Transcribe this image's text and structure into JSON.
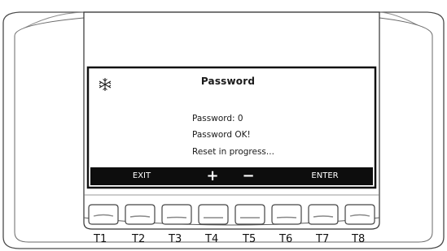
{
  "screen": {
    "title": "Password",
    "lines": [
      "Password:  0",
      "Password OK!",
      "Reset in progress..."
    ]
  },
  "softkeys": {
    "exit": "EXIT",
    "plus": "+",
    "minus": "−",
    "enter": "ENTER"
  },
  "buttons": [
    "T1",
    "T2",
    "T3",
    "T4",
    "T5",
    "T6",
    "T7",
    "T8"
  ],
  "icons": {
    "status": "snowflake-icon"
  },
  "colors": {
    "lcd_bar": "#0d0d0d",
    "lcd_background": "#ffffff"
  }
}
